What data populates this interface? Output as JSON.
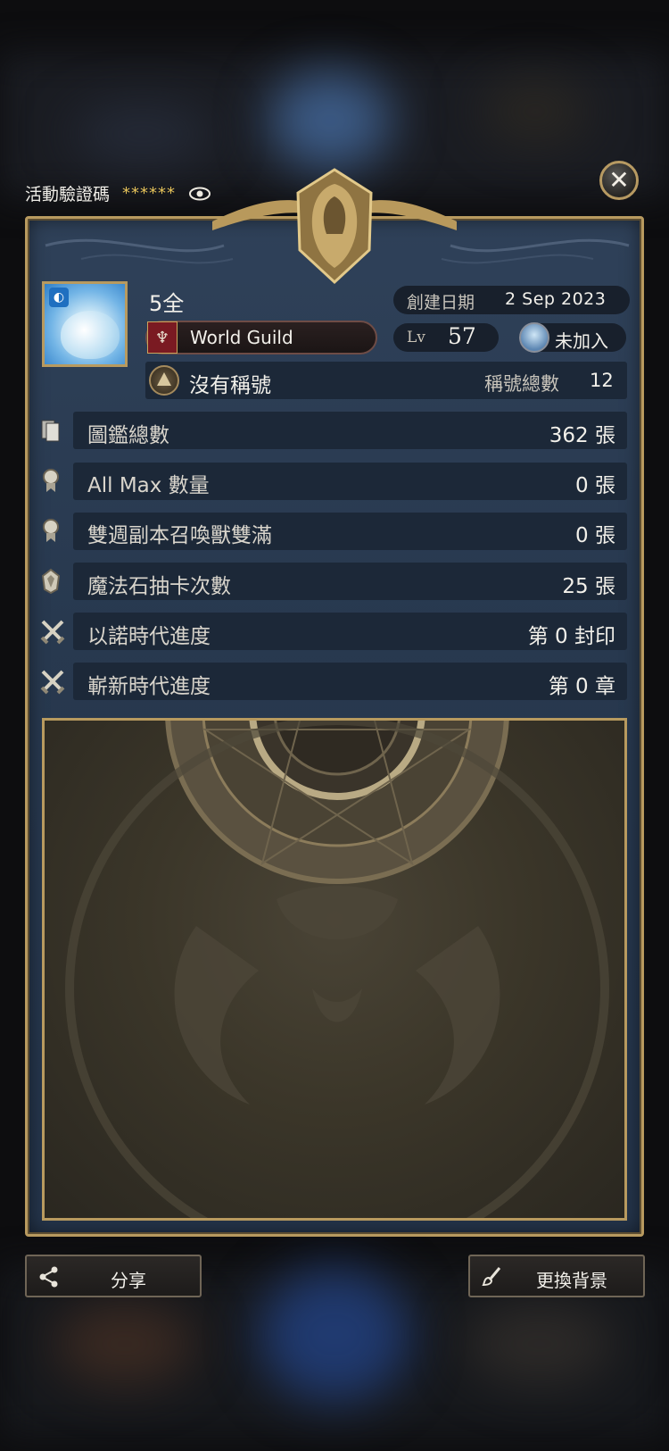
{
  "header": {
    "code_label": "活動驗證碼",
    "code_value": "******",
    "eye_icon": "eye-icon",
    "close_icon": "close-icon"
  },
  "profile": {
    "name": "5全",
    "guild": "World Guild",
    "created_label": "創建日期",
    "created_value": "2 Sep 2023",
    "level_label": "Lv",
    "level_value": "57",
    "join_label": "未加入",
    "title_text": "沒有稱號",
    "title_count_label": "稱號總數",
    "title_count_value": "12"
  },
  "stats": [
    {
      "label": "圖鑑總數",
      "value": "362 張",
      "icon": "cards-icon"
    },
    {
      "label": "All Max 數量",
      "value": "0 張",
      "icon": "medal-icon"
    },
    {
      "label": "雙週副本召喚獸雙滿",
      "value": "0 張",
      "icon": "medal-icon"
    },
    {
      "label": "魔法石抽卡次數",
      "value": "25 張",
      "icon": "stone-icon"
    },
    {
      "label": "以諾時代進度",
      "value": "第 0 封印",
      "icon": "crossed-swords-icon"
    },
    {
      "label": "嶄新時代進度",
      "value": "第 0 章",
      "icon": "crossed-swords-icon"
    }
  ],
  "buttons": {
    "share": "分享",
    "change_bg": "更換背景"
  },
  "colors": {
    "accent_gold": "#b89a5f",
    "panel_blue": "#2f4159",
    "row_dark": "#1c2838"
  }
}
